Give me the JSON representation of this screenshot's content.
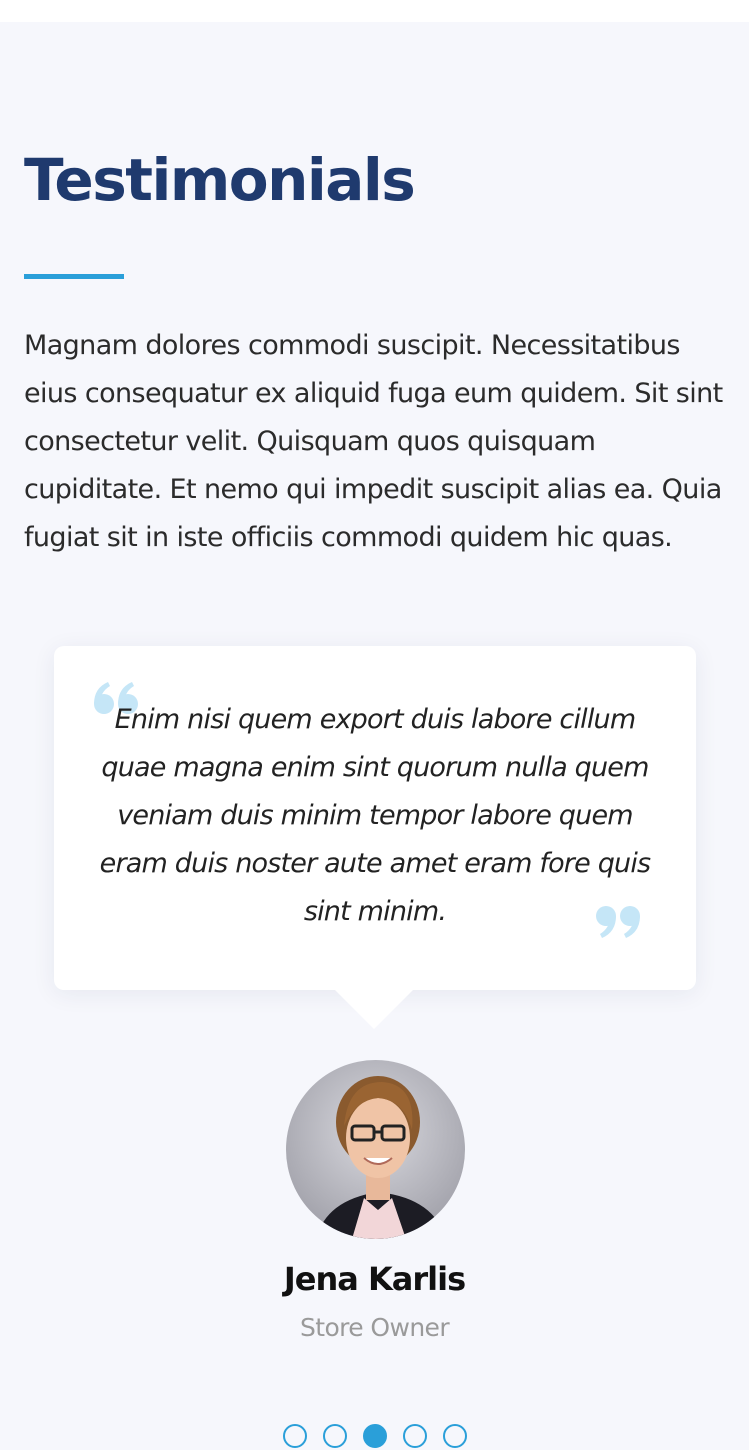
{
  "section": {
    "title": "Testimonials",
    "intro": "Magnam dolores commodi suscipit. Necessitatibus eius consequatur ex aliquid fuga eum quidem. Sit sint consectetur velit. Quisquam quos quisquam cupiditate. Et nemo qui impedit suscipit alias ea. Quia fugiat sit in iste officiis commodi quidem hic quas."
  },
  "testimonial": {
    "quote": "Enim nisi quem export duis labore cillum quae magna enim sint quorum nulla quem veniam duis minim tempor labore quem eram duis noster aute amet eram fore quis sint minim.",
    "name": "Jena Karlis",
    "role": "Store Owner",
    "avatar_icon": "person-photo"
  },
  "pagination": {
    "count": 5,
    "active_index": 2
  },
  "colors": {
    "title": "#1f3a6e",
    "accent": "#2a9fd9",
    "quote_icon": "#c5e6f7",
    "section_bg": "#f6f7fc",
    "role_text": "#9a9a9a"
  }
}
